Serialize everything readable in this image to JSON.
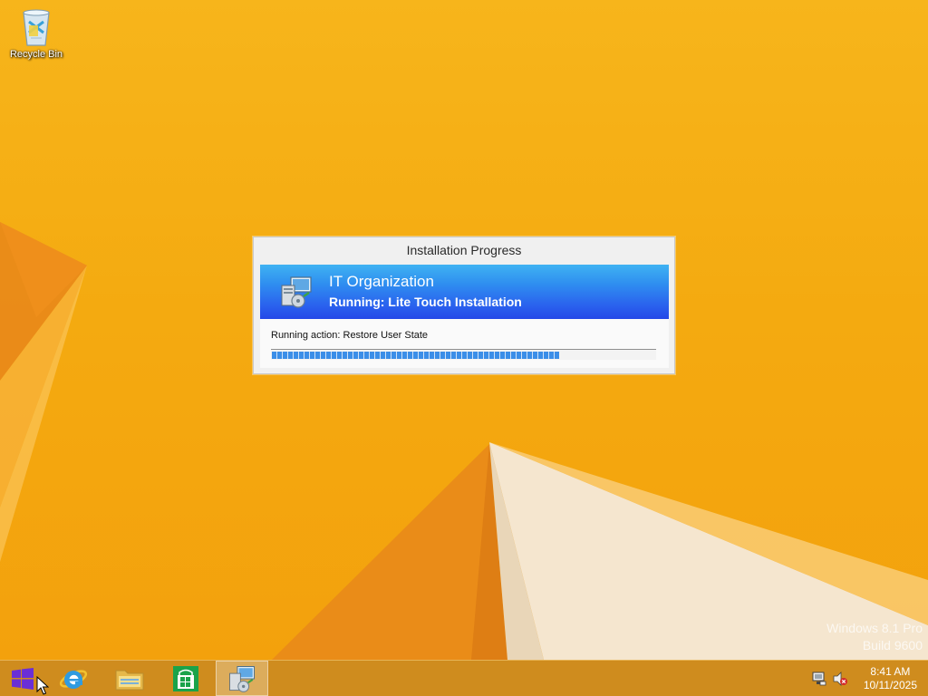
{
  "desktop": {
    "icons": [
      {
        "label": "Recycle Bin",
        "icon": "recycle-bin-icon"
      }
    ],
    "watermark": {
      "line1": "Windows 8.1 Pro",
      "line2": "Build 9600"
    }
  },
  "dialog": {
    "title": "Installation Progress",
    "organization": "IT Organization",
    "status": "Running: Lite Touch Installation",
    "action": "Running action: Restore User State",
    "progress_fraction": 0.75,
    "banner_icon": "deployment-computer-icon"
  },
  "taskbar": {
    "items": [
      {
        "name": "start",
        "icon": "windows-logo-icon"
      },
      {
        "name": "internet-explorer",
        "icon": "internet-explorer-icon"
      },
      {
        "name": "file-explorer",
        "icon": "folder-icon"
      },
      {
        "name": "store",
        "icon": "store-icon"
      },
      {
        "name": "deployment",
        "icon": "deployment-computer-icon",
        "active": true
      }
    ],
    "tray": {
      "network_icon": "network-icon",
      "volume_icon": "volume-muted-icon",
      "time": "8:41 AM",
      "date": "10/11/2025"
    }
  },
  "colors": {
    "wallpaper": "#f4aa10",
    "banner_top": "#3fb2f2",
    "banner_bottom": "#2448e8",
    "progress": "#3b8ee8",
    "start_button": "#6a2fd6"
  }
}
